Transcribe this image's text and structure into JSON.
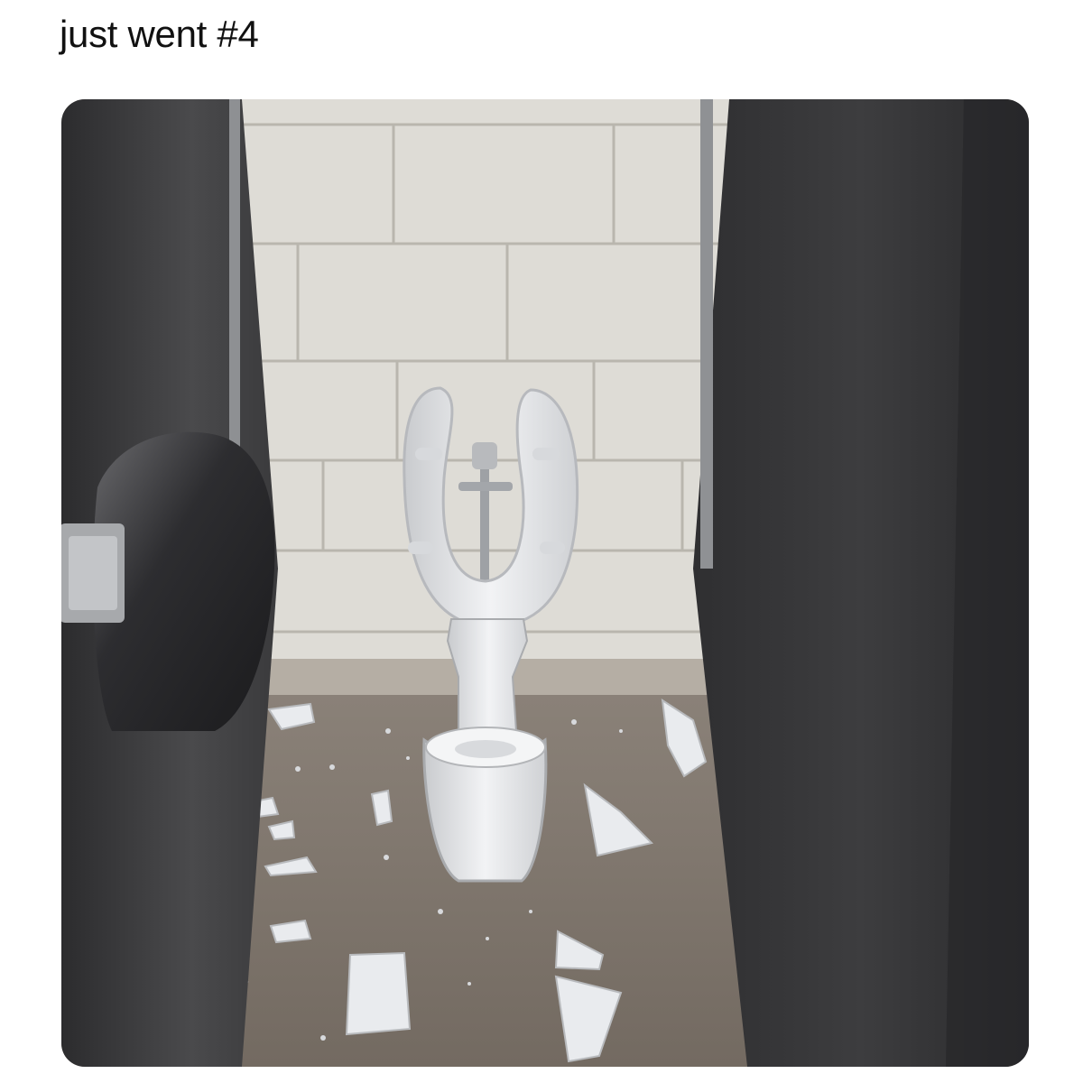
{
  "post": {
    "caption": "just went #4"
  },
  "media": {
    "kind": "photo",
    "colors": {
      "wall": "#dedcd6",
      "mortar": "#b9b6ae",
      "floor": "#7e756c",
      "stall_partition": "#3a3a3c",
      "porcelain": "#eceef0",
      "steel": "#a9abae",
      "background": "#ffffff",
      "text": "#111111"
    }
  }
}
